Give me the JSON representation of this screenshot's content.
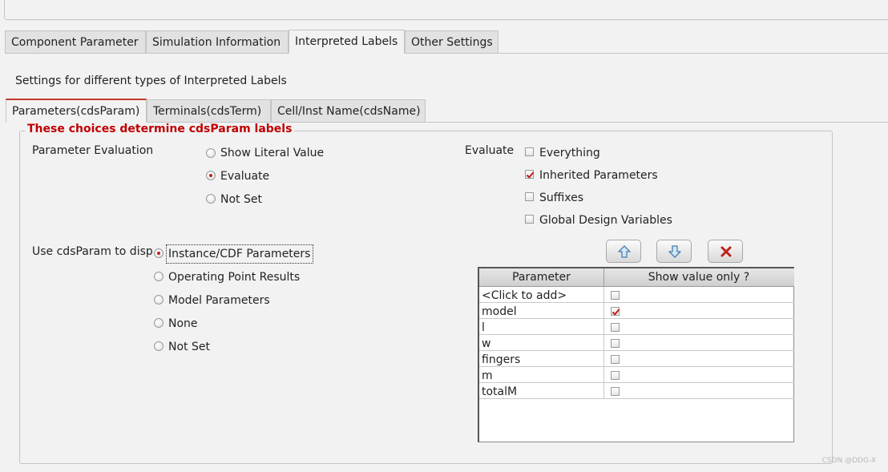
{
  "main_tabs": [
    {
      "label": "Component Parameter",
      "active": false
    },
    {
      "label": "Simulation Information",
      "active": false
    },
    {
      "label": "Interpreted Labels",
      "active": true
    },
    {
      "label": "Other Settings",
      "active": false
    }
  ],
  "description": "Settings for different types of Interpreted Labels",
  "sub_tabs": [
    {
      "label": "Parameters(cdsParam)",
      "active": true
    },
    {
      "label": "Terminals(cdsTerm)",
      "active": false
    },
    {
      "label": "Cell/Inst Name(cdsName)",
      "active": false
    }
  ],
  "group_title": "These choices determine cdsParam labels",
  "param_eval": {
    "label": "Parameter Evaluation",
    "options": [
      "Show Literal Value",
      "Evaluate",
      "Not Set"
    ],
    "selected": "Evaluate"
  },
  "evaluate": {
    "label": "Evaluate",
    "options": [
      {
        "label": "Everything",
        "checked": false
      },
      {
        "label": "Inherited Parameters",
        "checked": true
      },
      {
        "label": "Suffixes",
        "checked": false
      },
      {
        "label": "Global Design Variables",
        "checked": false
      }
    ]
  },
  "display": {
    "label": "Use cdsParam to disp",
    "options": [
      "Instance/CDF Parameters",
      "Operating Point Results",
      "Model Parameters",
      "None",
      "Not Set"
    ],
    "selected": "Instance/CDF Parameters"
  },
  "toolbar": {
    "up_icon": "arrow-up-icon",
    "down_icon": "arrow-down-icon",
    "delete_icon": "delete-x-icon"
  },
  "table": {
    "headers": [
      "Parameter",
      "Show value only ?"
    ],
    "rows": [
      {
        "name": "<Click to add>",
        "checked": false
      },
      {
        "name": "model",
        "checked": true
      },
      {
        "name": "l",
        "checked": false
      },
      {
        "name": "w",
        "checked": false
      },
      {
        "name": "fingers",
        "checked": false
      },
      {
        "name": "m",
        "checked": false
      },
      {
        "name": "totalM",
        "checked": false
      }
    ]
  },
  "watermark": "CSDN @DDG-X",
  "colors": {
    "accent": "#c0201a",
    "group_title": "#c00000"
  }
}
